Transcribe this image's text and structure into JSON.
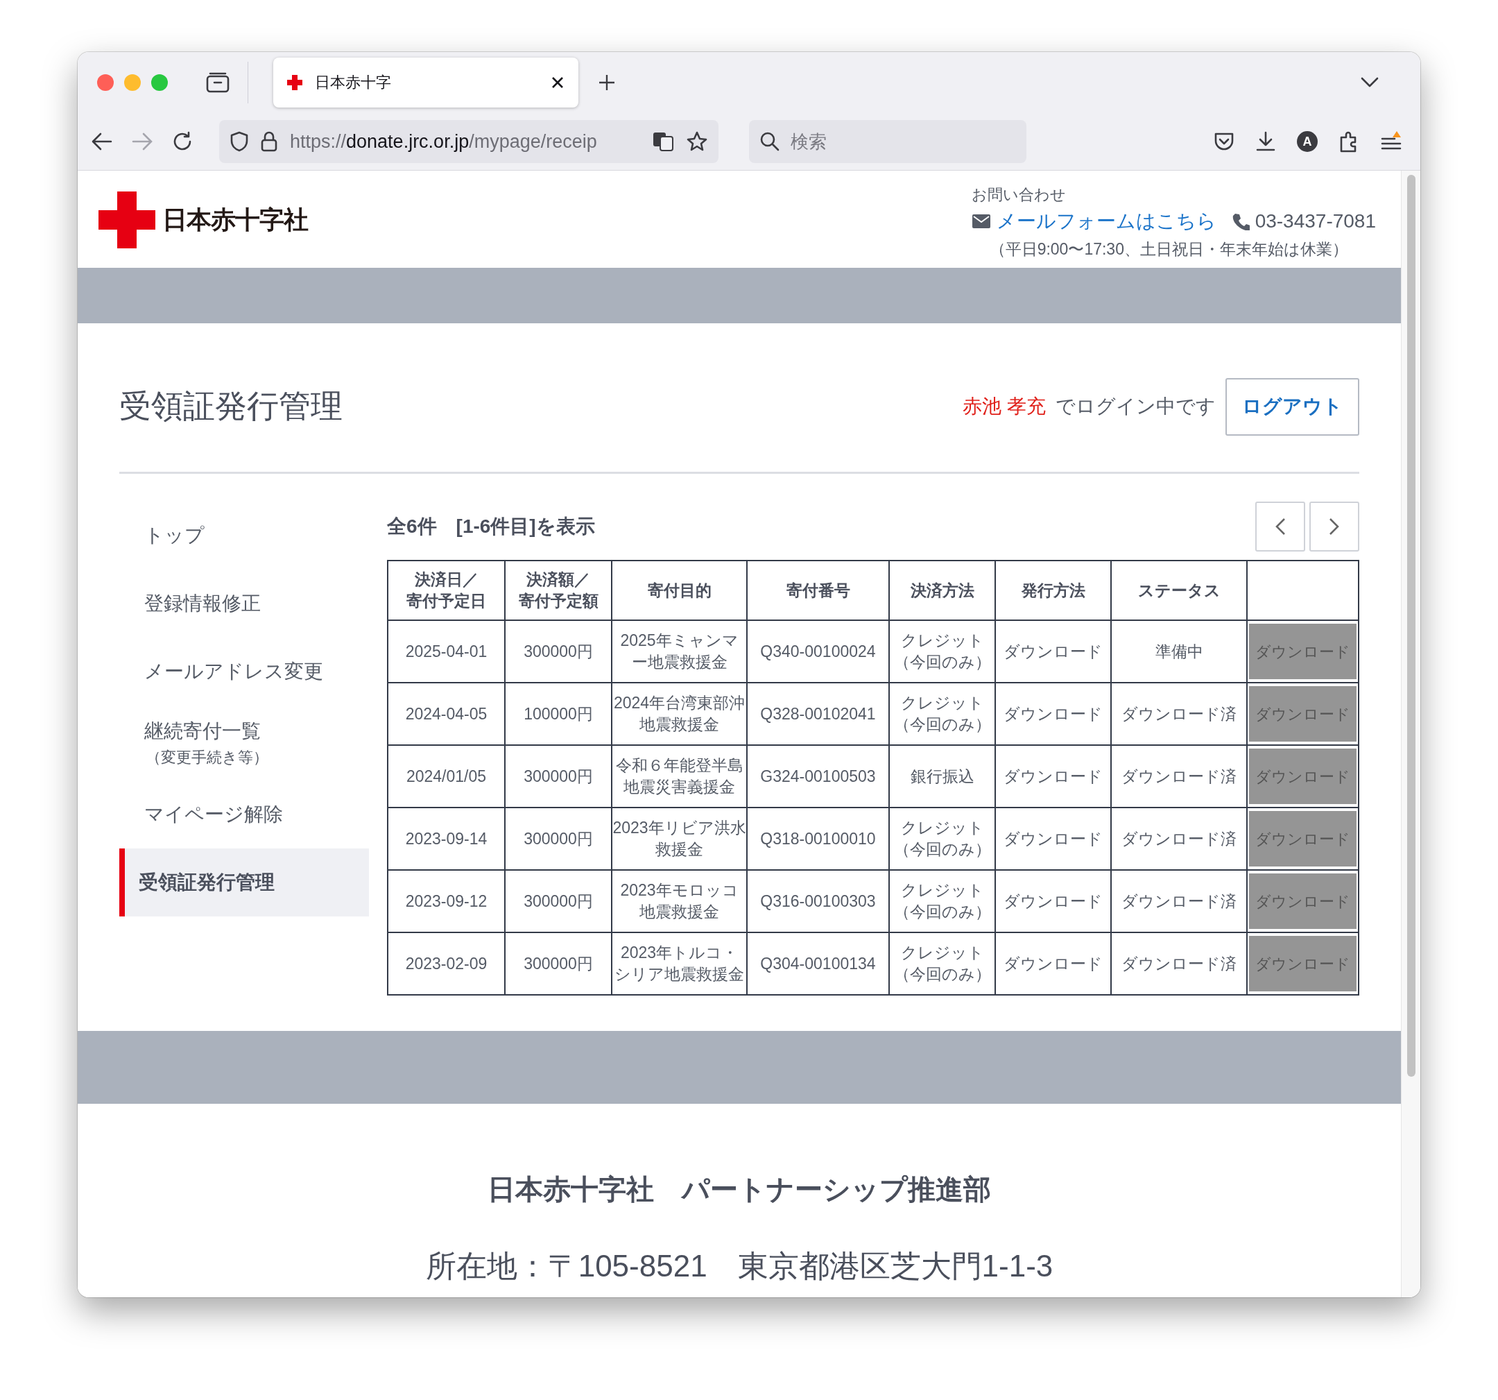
{
  "browser": {
    "tab": {
      "title": "日本赤十字",
      "selected": true
    },
    "url": {
      "scheme": "https://",
      "domain": "donate.jrc.or.jp",
      "path": "/mypage/receip"
    },
    "search": {
      "placeholder": "検索"
    },
    "avatar_letter": "A"
  },
  "header": {
    "logo_text": "日本赤十字社",
    "contact_label": "お問い合わせ",
    "mail_link": "メールフォームはこちら",
    "phone": "03-3437-7081",
    "hours": "（平日9:00〜17:30、土日祝日・年末年始は休業）"
  },
  "page": {
    "title": "受領証発行管理",
    "user_name": "赤池 孝充",
    "login_suffix": "でログイン中です",
    "logout": "ログアウト"
  },
  "sidebar": {
    "items": [
      {
        "label": "トップ",
        "selected": false
      },
      {
        "label": "登録情報修正",
        "selected": false
      },
      {
        "label": "メールアドレス変更",
        "selected": false
      },
      {
        "label": "継続寄付一覧",
        "note": "（変更手続き等）",
        "selected": false
      },
      {
        "label": "マイページ解除",
        "selected": false
      },
      {
        "label": "受領証発行管理",
        "selected": true
      }
    ]
  },
  "table": {
    "summary": "全6件　[1-6件目]を表示",
    "columns": [
      {
        "lines": [
          "決済日／",
          "寄付予定日"
        ]
      },
      {
        "lines": [
          "決済額／",
          "寄付予定額"
        ]
      },
      {
        "lines": [
          "寄付目的"
        ]
      },
      {
        "lines": [
          "寄付番号"
        ]
      },
      {
        "lines": [
          "決済方法"
        ]
      },
      {
        "lines": [
          "発行方法"
        ]
      },
      {
        "lines": [
          "ステータス"
        ]
      }
    ],
    "rows": [
      {
        "date": "2025-04-01",
        "amount": "300000円",
        "purpose": "2025年ミャンマー地震救援金",
        "number": "Q340-00100024",
        "payment": "クレジット",
        "payment_note": "（今回のみ）",
        "issue": "ダウンロード",
        "status": "準備中",
        "action": {
          "label": "ダウンロード",
          "disabled": true
        }
      },
      {
        "date": "2024-04-05",
        "amount": "100000円",
        "purpose": "2024年台湾東部沖地震救援金",
        "number": "Q328-00102041",
        "payment": "クレジット",
        "payment_note": "（今回のみ）",
        "issue": "ダウンロード",
        "status": "ダウンロード済",
        "action": {
          "label": "ダウンロード",
          "disabled": true
        }
      },
      {
        "date": "2024/01/05",
        "amount": "300000円",
        "purpose": "令和６年能登半島地震災害義援金",
        "number": "G324-00100503",
        "payment": "銀行振込",
        "issue": "ダウンロード",
        "status": "ダウンロード済",
        "action": {
          "label": "ダウンロード",
          "disabled": true
        }
      },
      {
        "date": "2023-09-14",
        "amount": "300000円",
        "purpose": "2023年リビア洪水救援金",
        "number": "Q318-00100010",
        "payment": "クレジット",
        "payment_note": "（今回のみ）",
        "issue": "ダウンロード",
        "status": "ダウンロード済",
        "action": {
          "label": "ダウンロード",
          "disabled": true
        }
      },
      {
        "date": "2023-09-12",
        "amount": "300000円",
        "purpose": "2023年モロッコ地震救援金",
        "number": "Q316-00100303",
        "payment": "クレジット",
        "payment_note": "（今回のみ）",
        "issue": "ダウンロード",
        "status": "ダウンロード済",
        "action": {
          "label": "ダウンロード",
          "disabled": true
        }
      },
      {
        "date": "2023-02-09",
        "amount": "300000円",
        "purpose": "2023年トルコ・シリア地震救援金",
        "number": "Q304-00100134",
        "payment": "クレジット",
        "payment_note": "（今回のみ）",
        "issue": "ダウンロード",
        "status": "ダウンロード済",
        "action": {
          "label": "ダウンロード",
          "disabled": true
        }
      }
    ]
  },
  "footer": {
    "org": "日本赤十字社　パートナーシップ推進部",
    "address": "所在地：〒105-8521　東京都港区芝大門1-1-3"
  }
}
